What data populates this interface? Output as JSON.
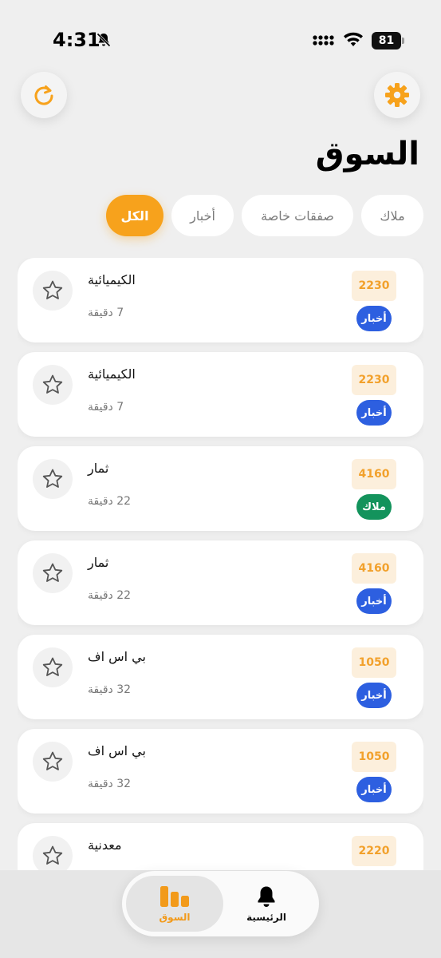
{
  "status_bar": {
    "time": "4:31",
    "battery": "81"
  },
  "header": {
    "title": "السوق"
  },
  "filters": [
    {
      "label": "الكل",
      "active": true
    },
    {
      "label": "أخبار",
      "active": false
    },
    {
      "label": "صفقات خاصة",
      "active": false
    },
    {
      "label": "ملاك",
      "active": false
    }
  ],
  "items": [
    {
      "title": "الكيميائية",
      "time": "7 دقيقة",
      "price": "2230",
      "badge": "أخبار",
      "badge_color": "#2d5fe0"
    },
    {
      "title": "الكيميائية",
      "time": "7 دقيقة",
      "price": "2230",
      "badge": "أخبار",
      "badge_color": "#2d5fe0"
    },
    {
      "title": "ثمار",
      "time": "22 دقيقة",
      "price": "4160",
      "badge": "ملاك",
      "badge_color": "#13935c"
    },
    {
      "title": "ثمار",
      "time": "22 دقيقة",
      "price": "4160",
      "badge": "أخبار",
      "badge_color": "#2d5fe0"
    },
    {
      "title": "بي اس اف",
      "time": "32 دقيقة",
      "price": "1050",
      "badge": "أخبار",
      "badge_color": "#2d5fe0"
    },
    {
      "title": "بي اس اف",
      "time": "32 دقيقة",
      "price": "1050",
      "badge": "أخبار",
      "badge_color": "#2d5fe0"
    },
    {
      "title": "معدنية",
      "time": "",
      "price": "2220",
      "badge": "",
      "badge_color": "#2d5fe0"
    }
  ],
  "bottom_nav": {
    "market_label": "السوق",
    "home_label": "الرئيسية"
  },
  "colors": {
    "accent": "#f7a21c",
    "news_badge": "#2d5fe0",
    "owners_badge": "#13935c"
  },
  "icons": {
    "refresh": "refresh-icon",
    "settings": "gear-icon",
    "star": "star-icon",
    "market": "bar-chart-icon",
    "home": "bell-icon"
  }
}
